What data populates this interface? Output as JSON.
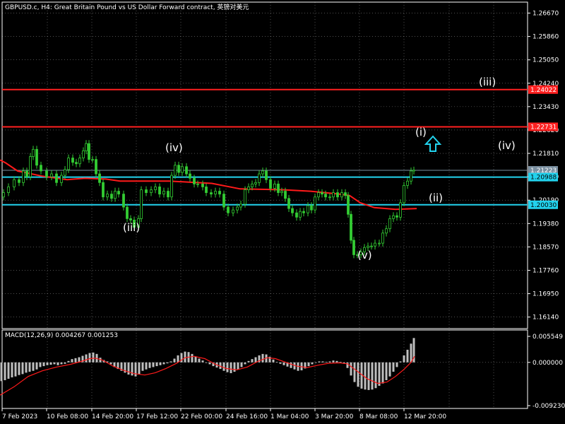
{
  "window": {
    "title": "GBPUSD.c, H4:  Great Britain Pound vs US Dollar Forward contract, 英镑对美元"
  },
  "colors": {
    "background": "#000000",
    "candle": "#33cc33",
    "ma": "#ff1a1a",
    "resistance": "#ff2020",
    "support": "#22d3ee",
    "current_price": "#7a8fa0",
    "histogram": "#bfbfbf",
    "signal": "#ff1a1a",
    "grid": "#ffffff",
    "arrow": "#22d3ee"
  },
  "price_axis": {
    "labels": [
      "1.26670",
      "1.25860",
      "1.25050",
      "1.24240",
      "1.23430",
      "1.22620",
      "1.21810",
      "1.21000",
      "1.20190",
      "1.19380",
      "1.18570",
      "1.17760",
      "1.16950",
      "1.16140"
    ],
    "ymin": 1.1574,
    "ymax": 1.2705
  },
  "time_axis": {
    "labels": [
      "7 Feb 2023",
      "10 Feb 08:00",
      "14 Feb 20:00",
      "17 Feb 12:00",
      "22 Feb 00:00",
      "24 Feb 16:00",
      "1 Mar 04:00",
      "3 Mar 20:00",
      "8 Mar 08:00",
      "12 Mar 20:00"
    ]
  },
  "levels": {
    "resistance_1": {
      "price": 1.2402,
      "label": "1.24022"
    },
    "resistance_2": {
      "price": 1.2273,
      "label": "1.22731"
    },
    "current": {
      "price": 1.21223,
      "label": "1.21223"
    },
    "support_1": {
      "price": 1.20988,
      "label": "1.20988"
    },
    "support_2": {
      "price": 1.2003,
      "label": "1.20030"
    }
  },
  "waves": {
    "left_iv": "(iv)",
    "left_iii": "(iii)",
    "v": "(v)",
    "i": "(i)",
    "ii": "(ii)",
    "iii": "(iii)",
    "iv": "(iv)"
  },
  "macd": {
    "label": "MACD(12,26,9) 0.004267 0.001253",
    "axis_labels": [
      "0.005549",
      "0.000000",
      "-0.009230"
    ],
    "ymin": -0.00923,
    "ymax": 0.00555
  },
  "chart_data": {
    "type": "candlestick",
    "title": "GBPUSD.c, H4",
    "ma": [
      [
        0,
        1.2158
      ],
      [
        8,
        1.2148
      ],
      [
        25,
        1.212
      ],
      [
        45,
        1.211
      ],
      [
        60,
        1.2102
      ],
      [
        95,
        1.209
      ],
      [
        120,
        1.2095
      ],
      [
        150,
        1.2092
      ],
      [
        170,
        1.2085
      ],
      [
        240,
        1.2085
      ],
      [
        300,
        1.2077
      ],
      [
        340,
        1.2058
      ],
      [
        400,
        1.2055
      ],
      [
        440,
        1.205
      ],
      [
        480,
        1.204
      ],
      [
        495,
        1.2035
      ],
      [
        510,
        1.201
      ],
      [
        530,
        1.1993
      ],
      [
        560,
        1.1987
      ],
      [
        590,
        1.199
      ]
    ],
    "close": [
      [
        0,
        1.203
      ],
      [
        5,
        1.2045
      ],
      [
        12,
        1.2065
      ],
      [
        20,
        1.209
      ],
      [
        27,
        1.208
      ],
      [
        33,
        1.212
      ],
      [
        38,
        1.21
      ],
      [
        43,
        1.217
      ],
      [
        47,
        1.2195
      ],
      [
        52,
        1.214
      ],
      [
        58,
        1.212
      ],
      [
        66,
        1.21
      ],
      [
        73,
        1.211
      ],
      [
        80,
        1.208
      ],
      [
        87,
        1.2105
      ],
      [
        92,
        1.2125
      ],
      [
        97,
        1.2165
      ],
      [
        103,
        1.215
      ],
      [
        108,
        1.2145
      ],
      [
        113,
        1.2165
      ],
      [
        118,
        1.219
      ],
      [
        122,
        1.2215
      ],
      [
        126,
        1.216
      ],
      [
        131,
        1.216
      ],
      [
        136,
        1.211
      ],
      [
        141,
        1.208
      ],
      [
        146,
        1.203
      ],
      [
        152,
        1.204
      ],
      [
        158,
        1.2025
      ],
      [
        163,
        1.205
      ],
      [
        168,
        1.204
      ],
      [
        175,
        1.1995
      ],
      [
        180,
        1.1955
      ],
      [
        185,
        1.195
      ],
      [
        190,
        1.1925
      ],
      [
        196,
        1.1955
      ],
      [
        200,
        1.2055
      ],
      [
        207,
        1.2045
      ],
      [
        214,
        1.2055
      ],
      [
        220,
        1.2065
      ],
      [
        226,
        1.204
      ],
      [
        232,
        1.205
      ],
      [
        238,
        1.203
      ],
      [
        243,
        1.2105
      ],
      [
        248,
        1.214
      ],
      [
        253,
        1.2115
      ],
      [
        258,
        1.2135
      ],
      [
        264,
        1.211
      ],
      [
        269,
        1.2095
      ],
      [
        275,
        1.2075
      ],
      [
        280,
        1.2075
      ],
      [
        287,
        1.2065
      ],
      [
        292,
        1.2045
      ],
      [
        299,
        1.204
      ],
      [
        305,
        1.205
      ],
      [
        311,
        1.204
      ],
      [
        317,
        1.1995
      ],
      [
        323,
        1.1975
      ],
      [
        330,
        1.1985
      ],
      [
        336,
        1.1995
      ],
      [
        341,
        1.2005
      ],
      [
        347,
        1.2055
      ],
      [
        352,
        1.2065
      ],
      [
        357,
        1.2075
      ],
      [
        362,
        1.208
      ],
      [
        367,
        1.211
      ],
      [
        372,
        1.212
      ],
      [
        377,
        1.209
      ],
      [
        383,
        1.206
      ],
      [
        389,
        1.2075
      ],
      [
        394,
        1.2045
      ],
      [
        399,
        1.205
      ],
      [
        404,
        1.2025
      ],
      [
        409,
        1.199
      ],
      [
        414,
        1.1975
      ],
      [
        420,
        1.196
      ],
      [
        425,
        1.198
      ],
      [
        430,
        1.1975
      ],
      [
        436,
        1.2
      ],
      [
        441,
        1.1985
      ],
      [
        446,
        1.203
      ],
      [
        451,
        1.2045
      ],
      [
        456,
        1.204
      ],
      [
        461,
        1.203
      ],
      [
        467,
        1.203
      ],
      [
        472,
        1.2045
      ],
      [
        478,
        1.203
      ],
      [
        484,
        1.2045
      ],
      [
        489,
        1.2035
      ],
      [
        493,
        1.197
      ],
      [
        497,
        1.188
      ],
      [
        501,
        1.183
      ],
      [
        506,
        1.183
      ],
      [
        511,
        1.184
      ],
      [
        516,
        1.1855
      ],
      [
        521,
        1.186
      ],
      [
        526,
        1.186
      ],
      [
        531,
        1.187
      ],
      [
        537,
        1.187
      ],
      [
        542,
        1.1905
      ],
      [
        547,
        1.192
      ],
      [
        552,
        1.1955
      ],
      [
        557,
        1.1965
      ],
      [
        562,
        1.196
      ],
      [
        567,
        1.201
      ],
      [
        572,
        1.207
      ],
      [
        577,
        1.2085
      ],
      [
        582,
        1.212
      ],
      [
        586,
        1.2123
      ]
    ],
    "macd_hist": [
      [
        2,
        -0.004
      ],
      [
        7,
        -0.0038
      ],
      [
        12,
        -0.0035
      ],
      [
        17,
        -0.0032
      ],
      [
        22,
        -0.003
      ],
      [
        27,
        -0.0027
      ],
      [
        32,
        -0.0025
      ],
      [
        37,
        -0.0022
      ],
      [
        42,
        -0.002
      ],
      [
        47,
        -0.0018
      ],
      [
        52,
        -0.0015
      ],
      [
        57,
        -0.001
      ],
      [
        62,
        -0.0008
      ],
      [
        67,
        -0.0006
      ],
      [
        72,
        -0.0005
      ],
      [
        77,
        -0.0004
      ],
      [
        82,
        -0.0006
      ],
      [
        87,
        -0.0004
      ],
      [
        92,
        -0.0003
      ],
      [
        97,
        0.0003
      ],
      [
        102,
        0.0007
      ],
      [
        107,
        0.0009
      ],
      [
        112,
        0.0011
      ],
      [
        117,
        0.0014
      ],
      [
        122,
        0.0017
      ],
      [
        127,
        0.002
      ],
      [
        132,
        0.0021
      ],
      [
        137,
        0.0018
      ],
      [
        142,
        0.001
      ],
      [
        147,
        0.0005
      ],
      [
        152,
        0.0002
      ],
      [
        157,
        -0.0004
      ],
      [
        162,
        -0.001
      ],
      [
        167,
        -0.0014
      ],
      [
        172,
        -0.0018
      ],
      [
        177,
        -0.0022
      ],
      [
        182,
        -0.0026
      ],
      [
        187,
        -0.0028
      ],
      [
        192,
        -0.003
      ],
      [
        197,
        -0.0025
      ],
      [
        202,
        -0.0018
      ],
      [
        207,
        -0.0015
      ],
      [
        212,
        -0.0012
      ],
      [
        217,
        -0.001
      ],
      [
        222,
        -0.0008
      ],
      [
        227,
        -0.0006
      ],
      [
        232,
        -0.0004
      ],
      [
        237,
        -0.0002
      ],
      [
        242,
        0.0002
      ],
      [
        247,
        0.0008
      ],
      [
        252,
        0.0015
      ],
      [
        257,
        0.002
      ],
      [
        262,
        0.0023
      ],
      [
        267,
        0.0022
      ],
      [
        272,
        0.0018
      ],
      [
        277,
        0.0012
      ],
      [
        282,
        0.0008
      ],
      [
        287,
        0.0004
      ],
      [
        292,
        0.0
      ],
      [
        297,
        -0.0004
      ],
      [
        302,
        -0.0008
      ],
      [
        307,
        -0.0011
      ],
      [
        312,
        -0.0014
      ],
      [
        317,
        -0.0018
      ],
      [
        322,
        -0.0021
      ],
      [
        327,
        -0.0023
      ],
      [
        332,
        -0.002
      ],
      [
        337,
        -0.0015
      ],
      [
        342,
        -0.001
      ],
      [
        347,
        -0.0004
      ],
      [
        352,
        0.0003
      ],
      [
        357,
        0.0007
      ],
      [
        362,
        0.0011
      ],
      [
        367,
        0.0015
      ],
      [
        372,
        0.0018
      ],
      [
        377,
        0.0017
      ],
      [
        382,
        0.0012
      ],
      [
        387,
        0.0006
      ],
      [
        392,
        0.0001
      ],
      [
        397,
        -0.0003
      ],
      [
        402,
        -0.0006
      ],
      [
        407,
        -0.0009
      ],
      [
        412,
        -0.0012
      ],
      [
        417,
        -0.0015
      ],
      [
        422,
        -0.0018
      ],
      [
        427,
        -0.0017
      ],
      [
        432,
        -0.0013
      ],
      [
        437,
        -0.0008
      ],
      [
        442,
        -0.0004
      ],
      [
        447,
        0.0
      ],
      [
        452,
        0.0002
      ],
      [
        457,
        0.0002
      ],
      [
        462,
        0.0001
      ],
      [
        467,
        0.0002
      ],
      [
        472,
        0.0004
      ],
      [
        477,
        0.0003
      ],
      [
        482,
        0.0001
      ],
      [
        487,
        -0.0002
      ],
      [
        492,
        -0.0012
      ],
      [
        497,
        -0.0028
      ],
      [
        502,
        -0.0042
      ],
      [
        507,
        -0.0052
      ],
      [
        512,
        -0.0056
      ],
      [
        517,
        -0.0058
      ],
      [
        522,
        -0.0059
      ],
      [
        527,
        -0.0058
      ],
      [
        532,
        -0.0055
      ],
      [
        537,
        -0.005
      ],
      [
        542,
        -0.0045
      ],
      [
        547,
        -0.0038
      ],
      [
        552,
        -0.003
      ],
      [
        557,
        -0.002
      ],
      [
        562,
        -0.001
      ],
      [
        567,
        0.0002
      ],
      [
        572,
        0.0015
      ],
      [
        577,
        0.0027
      ],
      [
        582,
        0.004
      ],
      [
        586,
        0.0052
      ]
    ],
    "macd_signal": [
      [
        0,
        -0.007
      ],
      [
        20,
        -0.0052
      ],
      [
        40,
        -0.003
      ],
      [
        60,
        -0.0018
      ],
      [
        80,
        -0.001
      ],
      [
        100,
        -0.0004
      ],
      [
        115,
        0.0002
      ],
      [
        127,
        0.0008
      ],
      [
        135,
        0.0009
      ],
      [
        145,
        0.0005
      ],
      [
        160,
        -0.0008
      ],
      [
        175,
        -0.0017
      ],
      [
        190,
        -0.0024
      ],
      [
        205,
        -0.0027
      ],
      [
        220,
        -0.0022
      ],
      [
        235,
        -0.0013
      ],
      [
        250,
        -0.0002
      ],
      [
        262,
        0.001
      ],
      [
        275,
        0.0013
      ],
      [
        290,
        0.0008
      ],
      [
        305,
        -0.0004
      ],
      [
        320,
        -0.0013
      ],
      [
        335,
        -0.0016
      ],
      [
        350,
        -0.001
      ],
      [
        365,
        0.0002
      ],
      [
        378,
        0.001
      ],
      [
        390,
        0.0008
      ],
      [
        405,
        0.0
      ],
      [
        420,
        -0.0008
      ],
      [
        435,
        -0.0011
      ],
      [
        450,
        -0.0006
      ],
      [
        465,
        -0.0002
      ],
      [
        480,
        -0.0001
      ],
      [
        492,
        -0.0003
      ],
      [
        505,
        -0.0018
      ],
      [
        520,
        -0.0035
      ],
      [
        535,
        -0.0045
      ],
      [
        548,
        -0.0042
      ],
      [
        560,
        -0.003
      ],
      [
        572,
        -0.0015
      ],
      [
        582,
        0.0
      ],
      [
        587,
        0.0013
      ]
    ]
  }
}
